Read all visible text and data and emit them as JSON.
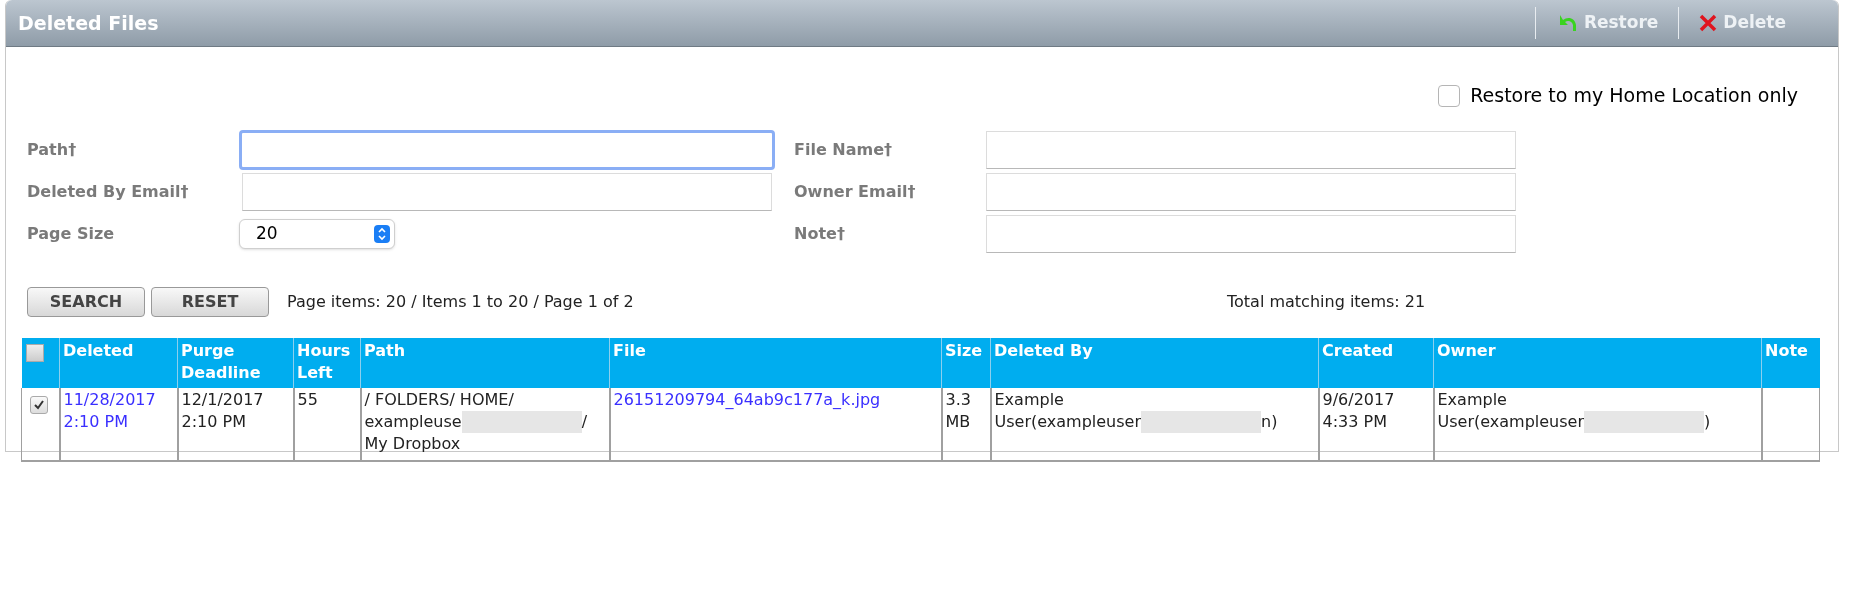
{
  "window": {
    "title": "Deleted Files"
  },
  "toolbar": [
    {
      "label": "Restore",
      "kind": "restore"
    },
    {
      "label": "Delete",
      "kind": "delete"
    }
  ],
  "restore_home_only": {
    "label": "Restore to my Home Location only",
    "checked": false
  },
  "form": {
    "left": [
      {
        "label": "Path†",
        "kind": "text",
        "focused": true
      },
      {
        "label": "Deleted By Email†",
        "kind": "text",
        "focused": false
      },
      {
        "label": "Page Size",
        "kind": "select",
        "value": "20"
      }
    ],
    "right": [
      {
        "label": "File Name†",
        "kind": "text",
        "focused": false
      },
      {
        "label": "Owner Email†",
        "kind": "text",
        "focused": false
      },
      {
        "label": "Note†",
        "kind": "text",
        "focused": false
      }
    ]
  },
  "buttons": [
    "SEARCH",
    "RESET"
  ],
  "paging": "Page items: 20 / Items 1 to 20 / Page 1 of 2",
  "total": "Total matching items: 21",
  "table": {
    "select_all_checked": false,
    "columns": [
      "Deleted",
      "Purge Deadline",
      "Hours Left",
      "Path",
      "File",
      "Size",
      "Deleted By",
      "Created",
      "Owner",
      "Note"
    ],
    "rows": [
      {
        "selected": true,
        "cells": [
          {
            "kind": "link",
            "text": "11/28/2017 2:10 PM"
          },
          {
            "kind": "plain",
            "text": "12/1/2017 2:10 PM"
          },
          {
            "kind": "plain",
            "text": "55"
          },
          {
            "kind": "redacted",
            "lines": [
              [
                {
                  "kind": "text",
                  "text": "/ FOLDERS/ HOME/"
                }
              ],
              [
                {
                  "kind": "text",
                  "text": "exampleuse"
                },
                {
                  "kind": "redacted"
                },
                {
                  "kind": "text",
                  "text": "/"
                }
              ],
              [
                {
                  "kind": "text",
                  "text": "My Dropbox"
                }
              ]
            ]
          },
          {
            "kind": "link",
            "text": "26151209794_64ab9c177a_k.jpg"
          },
          {
            "kind": "plain",
            "text": "3.3 MB"
          },
          {
            "kind": "redacted",
            "lines": [
              [
                {
                  "kind": "text",
                  "text": "Example"
                }
              ],
              [
                {
                  "kind": "text",
                  "text": "User(exampleuser"
                },
                {
                  "kind": "redacted"
                },
                {
                  "kind": "text",
                  "text": "n)"
                }
              ]
            ]
          },
          {
            "kind": "plain",
            "text": "9/6/2017 4:33 PM"
          },
          {
            "kind": "redacted",
            "lines": [
              [
                {
                  "kind": "text",
                  "text": "Example"
                }
              ],
              [
                {
                  "kind": "text",
                  "text": "User(exampleuser"
                },
                {
                  "kind": "redacted"
                },
                {
                  "kind": "text",
                  "text": ")"
                }
              ]
            ]
          },
          {
            "kind": "plain"
          }
        ]
      }
    ]
  }
}
